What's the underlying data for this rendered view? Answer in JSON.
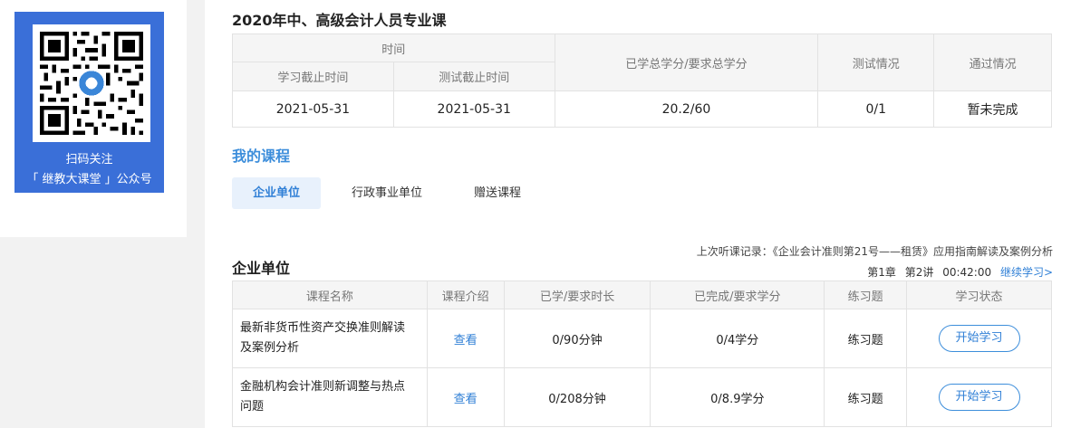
{
  "sidebar": {
    "qr_caption_line1": "扫码关注",
    "qr_caption_line2": "「 继教大课堂 」公众号"
  },
  "summary": {
    "title": "2020年中、高级会计人员专业课",
    "headers": {
      "time": "时间",
      "study_deadline": "学习截止时间",
      "test_deadline": "测试截止时间",
      "credits": "已学总学分/要求总学分",
      "test_status": "测试情况",
      "pass_status": "通过情况"
    },
    "row": {
      "study_deadline": "2021-05-31",
      "test_deadline": "2021-05-31",
      "credits": "20.2/60",
      "test_status": "0/1",
      "pass_status": "暂未完成"
    }
  },
  "my_courses": {
    "title": "我的课程",
    "tabs": [
      "企业单位",
      "行政事业单位",
      "赠送课程"
    ]
  },
  "course_list": {
    "title": "企业单位",
    "last_record_label": "上次听课记录：《企业会计准则第21号——租赁》应用指南解读及案例分析",
    "last_chapter": "第1章",
    "last_lecture": "第2讲",
    "last_time": "00:42:00",
    "continue_label": "继续学习>",
    "headers": [
      "课程名称",
      "课程介绍",
      "已学/要求时长",
      "已完成/要求学分",
      "练习题",
      "学习状态"
    ],
    "rows": [
      {
        "name_line1": "最新非货币性资产交换准则解读",
        "name_line2": "及案例分析",
        "intro": "查看",
        "duration": "0/90分钟",
        "credits": "0/4学分",
        "exercise": "练习题",
        "action": "开始学习"
      },
      {
        "name_line1": "金融机构会计准则新调整与热点",
        "name_line2": "问题",
        "intro": "查看",
        "duration": "0/208分钟",
        "credits": "0/8.9学分",
        "exercise": "练习题",
        "action": "开始学习"
      }
    ]
  }
}
